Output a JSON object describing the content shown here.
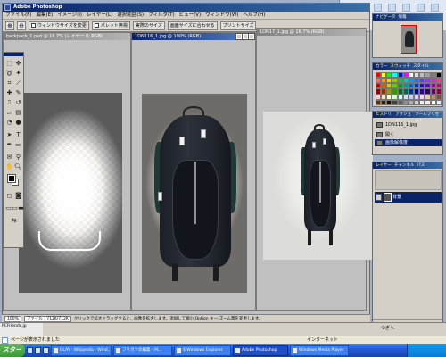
{
  "window": {
    "title": "Adobe Photoshop",
    "menus": [
      "ファイル(F)",
      "編集(E)",
      "イメージ(I)",
      "レイヤー(L)",
      "選択範囲(S)",
      "フィルタ(T)",
      "ビュー(V)",
      "ウィンドウ(W)",
      "ヘルプ(H)"
    ]
  },
  "options_bar": {
    "tools": [
      "zoom-in-icon",
      "zoom-out-icon"
    ],
    "resize_windows_label": "ウィンドウサイズを変更",
    "palette_label": "パレット無視",
    "actual_pixels": "実際のサイズ",
    "fit_screen": "画面サイズに合わせる",
    "print_size": "プリントサイズ"
  },
  "documents": [
    {
      "title": "backpack_1.psd @ 16.7% (レイヤー 0, RGB)",
      "active": false
    },
    {
      "title": "1DN116_1.jpg @ 100% (RGB)",
      "active": true
    },
    {
      "title": "1DN17_1.jpg @ 16.7% (RGB)",
      "active": false
    }
  ],
  "panels": {
    "navigator": {
      "tabs": [
        "ナビゲータ",
        "情報"
      ]
    },
    "color": {
      "tabs": [
        "カラー",
        "スウォッチ",
        "スタイル"
      ]
    },
    "history": {
      "tabs": [
        "ヒストリー",
        "アクション",
        "ツールプリセット"
      ],
      "items": [
        "1DN116_1.jpg",
        "開く",
        "画像解像度"
      ]
    },
    "layers": {
      "tabs": [
        "レイヤー",
        "チャンネル",
        "パス"
      ],
      "layer_name": "背景"
    }
  },
  "status": {
    "zoom": "100%",
    "doc_size": "ファイル : 712K/712K",
    "message": "クリックで拡大ドラッグすると、画像を拡大します。追加して縮小:Option キー:ズーム量を変更します。"
  },
  "browser": {
    "status_text": "ページが表示されました",
    "zone": "インターネット",
    "continue_label": "つぎへ",
    "media_label": "PCFriends.jp"
  },
  "taskbar": {
    "start": "スタート",
    "items": [
      "GLAY · Wikipedia - Wind...",
      "フリガナの編集 - M...",
      "4 Windows Explorer",
      "Adobe Photoshop",
      "Windows Media Player"
    ],
    "active_index": 3
  },
  "swatch_colors": [
    "#ff0000",
    "#ffff00",
    "#00ff00",
    "#00ffff",
    "#0000ff",
    "#ff00ff",
    "#ffffff",
    "#e0e0e0",
    "#c0c0c0",
    "#a0a0a0",
    "#808080",
    "#000000",
    "#ff6666",
    "#ff9900",
    "#ffcc00",
    "#99cc00",
    "#00cc66",
    "#00cccc",
    "#0099ff",
    "#3366ff",
    "#6633ff",
    "#9933ff",
    "#cc33cc",
    "#ff3399",
    "#cc0000",
    "#cc6600",
    "#cccc00",
    "#66cc00",
    "#009933",
    "#009999",
    "#0066cc",
    "#0033cc",
    "#3300cc",
    "#6600cc",
    "#990099",
    "#cc0066",
    "#990000",
    "#993300",
    "#999900",
    "#339900",
    "#006633",
    "#006666",
    "#003399",
    "#000099",
    "#330099",
    "#330066",
    "#660066",
    "#990033",
    "#ffcccc",
    "#ffe0b0",
    "#ffffcc",
    "#ccffcc",
    "#ccffff",
    "#cce0ff",
    "#ccccff",
    "#e0ccff",
    "#ffccff",
    "#f0c8a0",
    "#c89060",
    "#805030",
    "#603000",
    "#402000",
    "#201000",
    "#404040",
    "#606060",
    "#909090",
    "#b0b0b0",
    "#d0d0d0",
    "#f0f0f0",
    "#ffe8e8",
    "#e8ffe8",
    "#e8e8ff"
  ]
}
